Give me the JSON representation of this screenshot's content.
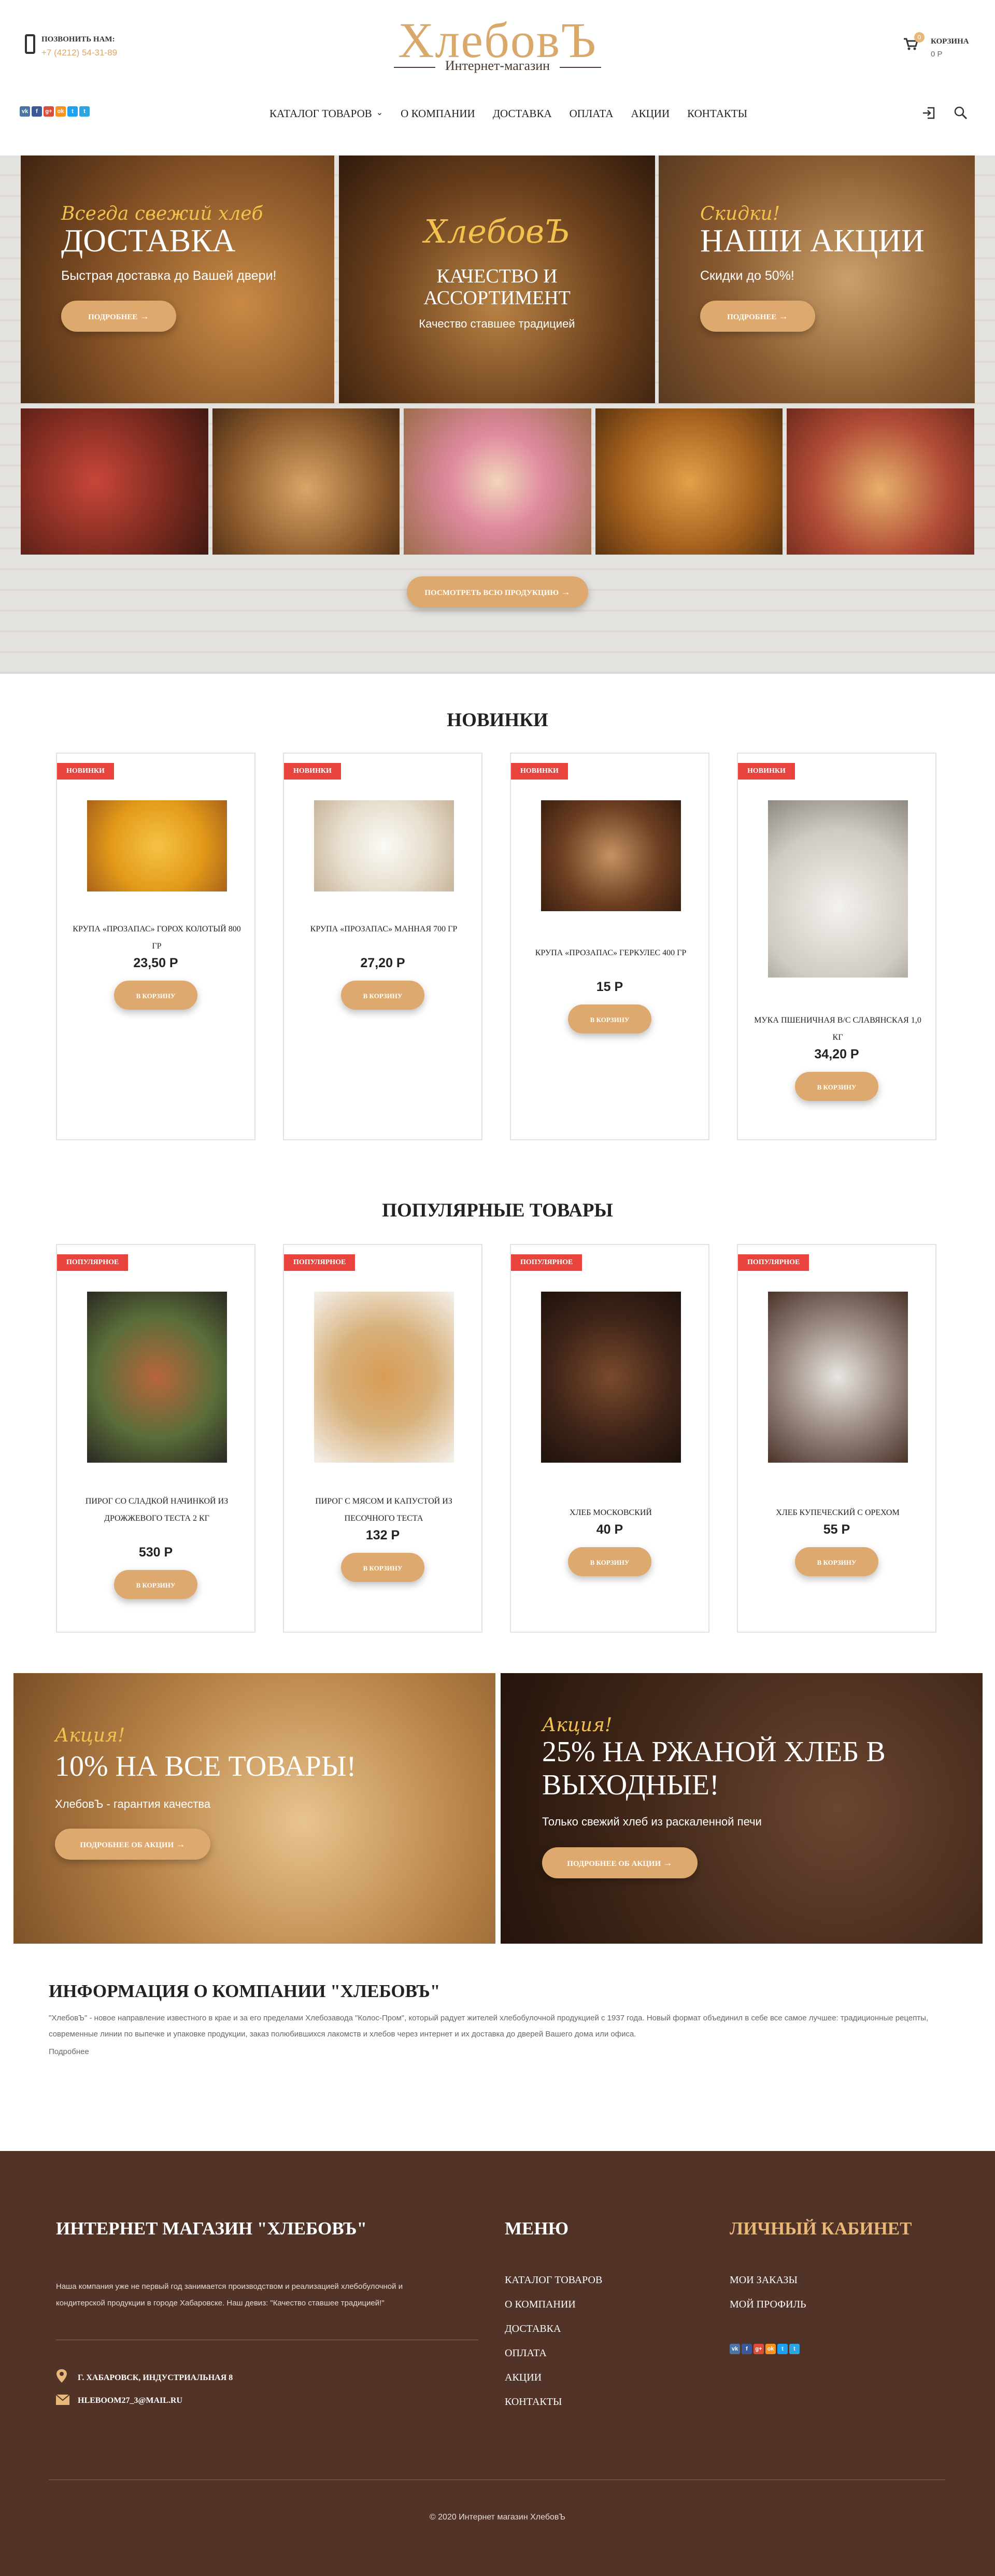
{
  "header": {
    "call_label": "ПОЗВОНИТЬ НАМ:",
    "phone": "+7 (4212) 54-31-89",
    "logo": "ХлебовЪ",
    "logo_sub": "Интернет-магазин",
    "cart_label": "КОРЗИНА",
    "cart_sum": "0 Р",
    "cart_count": "0",
    "socials": [
      {
        "label": "vk",
        "color": "#4c75a3"
      },
      {
        "label": "f",
        "color": "#3b5998"
      },
      {
        "label": "g+",
        "color": "#dd4b39"
      },
      {
        "label": "ok",
        "color": "#f7931e"
      },
      {
        "label": "t",
        "color": "#1da1f2"
      },
      {
        "label": "t",
        "color": "#2ca5e0"
      }
    ]
  },
  "nav": [
    "КАТАЛОГ ТОВАРОВ",
    "О КОМПАНИИ",
    "ДОСТАВКА",
    "ОПЛАТА",
    "АКЦИИ",
    "КОНТАКТЫ"
  ],
  "hero": {
    "b1": {
      "script": "Всегда свежий хлеб",
      "title": "ДОСТАВКА",
      "sub": "Быстрая доставка до Вашей двери!",
      "btn": "ПОДРОБНЕЕ"
    },
    "b2": {
      "script": "ХлебовЪ",
      "title": "КАЧЕСТВО И АССОРТИМЕНТ",
      "sub": "Качество ставшее традицией"
    },
    "b3": {
      "script": "Скидки!",
      "title": "НАШИ АКЦИИ",
      "sub": "Скидки до 50%!",
      "btn": "ПОДРОБНЕЕ"
    },
    "btn_all": "ПОСМОТРЕТЬ ВСЮ ПРОДУКЦИЮ"
  },
  "new": {
    "title": "НОВИНКИ",
    "badge": "НОВИНКИ",
    "items": [
      {
        "name": "Крупа «ПРОЗАПАС» Горох колотый 800 гр",
        "price": "23,50 Р",
        "btn": "В КОРЗИНУ"
      },
      {
        "name": "Крупа «ПРОЗАПАС» Манная 700 гр",
        "price": "27,20 Р",
        "btn": "В КОРЗИНУ"
      },
      {
        "name": "Крупа «ПРОЗАПАС» Геркулес 400 гр",
        "price": "15 Р",
        "btn": "В КОРЗИНУ"
      },
      {
        "name": "Мука пшеничная в/с славянская 1,0 кг",
        "price": "34,20 Р",
        "btn": "В КОРЗИНУ"
      }
    ]
  },
  "popular": {
    "title": "ПОПУЛЯРНЫЕ ТОВАРЫ",
    "badge": "ПОПУЛЯРНОЕ",
    "items": [
      {
        "name": "Пирог со сладкой начинкой из дрожжевого теста 2 кг",
        "price": "530 Р",
        "btn": "В КОРЗИНУ"
      },
      {
        "name": "Пирог с мясом и капустой из песочного теста",
        "price": "132 Р",
        "btn": "В КОРЗИНУ"
      },
      {
        "name": "Хлеб Московский",
        "price": "40 Р",
        "btn": "В КОРЗИНУ"
      },
      {
        "name": "Хлеб купеческий с орехом",
        "price": "55 Р",
        "btn": "В КОРЗИНУ"
      }
    ]
  },
  "promos": [
    {
      "script": "Акция!",
      "title": "10% НА ВСЕ ТОВАРЫ!",
      "sub": "ХлебовЪ - гарантия качества",
      "btn": "ПОДРОБНЕЕ ОБ АКЦИИ"
    },
    {
      "script": "Акция!",
      "title": "25% НА РЖАНОЙ ХЛЕБ В ВЫХОДНЫЕ!",
      "sub": "Только свежий хлеб из раскаленной печи",
      "btn": "ПОДРОБНЕЕ ОБ АКЦИИ"
    }
  ],
  "info": {
    "title": "ИНФОРМАЦИЯ О КОМПАНИИ \"ХЛЕБОВЪ\"",
    "text": "\"ХлебовЪ\" - новое направление известного в крае и за его пределами Хлебозавода \"Колос-Пром\", который радует жителей хлебобулочной продукцией с 1937 года. Новый формат объединил в себе все самое лучшее: традиционные рецепты, современные линии по выпечке и упаковке продукции, заказ полюбившихся лакомств и хлебов через интернет и их доставка до дверей Вашего дома или офиса.",
    "more": "Подробнее"
  },
  "footer": {
    "title1": "ИНТЕРНЕТ МАГАЗИН \"ХЛЕБОВЪ\"",
    "text1": "Наша компания уже не первый год занимается производством и реализацией хлебобулочной и кондитерской продукции в городе Хабаровске. Наш девиз: \"Качество ставшее традицией!\"",
    "address": "Г. ХАБАРОВСК, ИНДУСТРИАЛЬНАЯ 8",
    "email": "HLEBOOM27_3@MAIL.RU",
    "menu_title": "МЕНЮ",
    "menu": [
      "КАТАЛОГ ТОВАРОВ",
      "О КОМПАНИИ",
      "ДОСТАВКА",
      "ОПЛАТА",
      "АКЦИИ",
      "КОНТАКТЫ"
    ],
    "cabinet_title": "ЛИЧНЫЙ КАБИНЕТ",
    "cabinet": [
      "МОИ ЗАКАЗЫ",
      "МОЙ ПРОФИЛЬ"
    ],
    "copyright": "© 2020 Интернет магазин ХлебовЪ"
  },
  "colors": {
    "accent": "#dea96e",
    "badge": "#e8433d",
    "footer": "#513328",
    "logo": "#d9a86b",
    "cabinet_title": "#e8b77a"
  }
}
